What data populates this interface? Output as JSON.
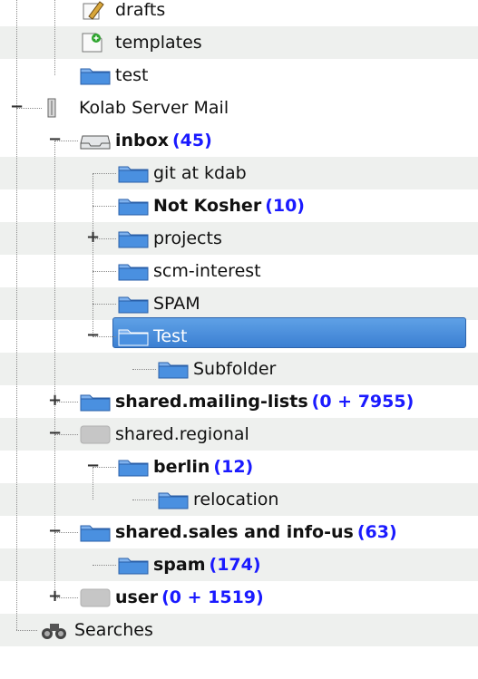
{
  "rows": [
    {
      "label": "drafts",
      "icon": "drafts-icon",
      "bold": false
    },
    {
      "label": "templates",
      "icon": "template-icon",
      "bold": false
    },
    {
      "label": "test",
      "icon": "folder-icon",
      "bold": false
    },
    {
      "label": "Kolab Server Mail",
      "icon": "server-icon",
      "bold": false,
      "expander": "−"
    },
    {
      "label": "inbox",
      "count": "(45)",
      "icon": "inbox-icon",
      "bold": true,
      "expander": "−"
    },
    {
      "label": "git at kdab",
      "icon": "folder-icon",
      "bold": false
    },
    {
      "label": "Not Kosher",
      "count": "(10)",
      "icon": "folder-icon",
      "bold": true
    },
    {
      "label": "projects",
      "icon": "folder-icon",
      "bold": false,
      "expander": "+"
    },
    {
      "label": "scm-interest",
      "icon": "folder-icon",
      "bold": false
    },
    {
      "label": "SPAM",
      "icon": "folder-icon",
      "bold": false
    },
    {
      "label": "Test",
      "icon": "folder-icon",
      "bold": false,
      "expander": "−",
      "selected": true
    },
    {
      "label": "Subfolder",
      "icon": "folder-icon",
      "bold": false
    },
    {
      "label": "shared.mailing-lists",
      "count": "(0 + 7955)",
      "icon": "folder-icon",
      "bold": true,
      "expander": "+"
    },
    {
      "label": "shared.regional",
      "icon": "gray-folder-icon",
      "bold": false,
      "expander": "−"
    },
    {
      "label": "berlin",
      "count": "(12)",
      "icon": "folder-icon",
      "bold": true,
      "expander": "−"
    },
    {
      "label": "relocation",
      "icon": "folder-icon",
      "bold": false
    },
    {
      "label": "shared.sales and info-us",
      "count": "(63)",
      "icon": "folder-icon",
      "bold": true,
      "expander": "−"
    },
    {
      "label": "spam",
      "count": "(174)",
      "icon": "folder-icon",
      "bold": true
    },
    {
      "label": "user",
      "count": "(0 + 1519)",
      "icon": "gray-folder-icon",
      "bold": true,
      "expander": "+"
    },
    {
      "label": "Searches",
      "icon": "binoculars-icon",
      "bold": false
    }
  ],
  "colors": {
    "accent": "#3b7fd2",
    "count": "#1a1aff",
    "folder": "#4a90e0",
    "stripe": "#eef0ee"
  }
}
